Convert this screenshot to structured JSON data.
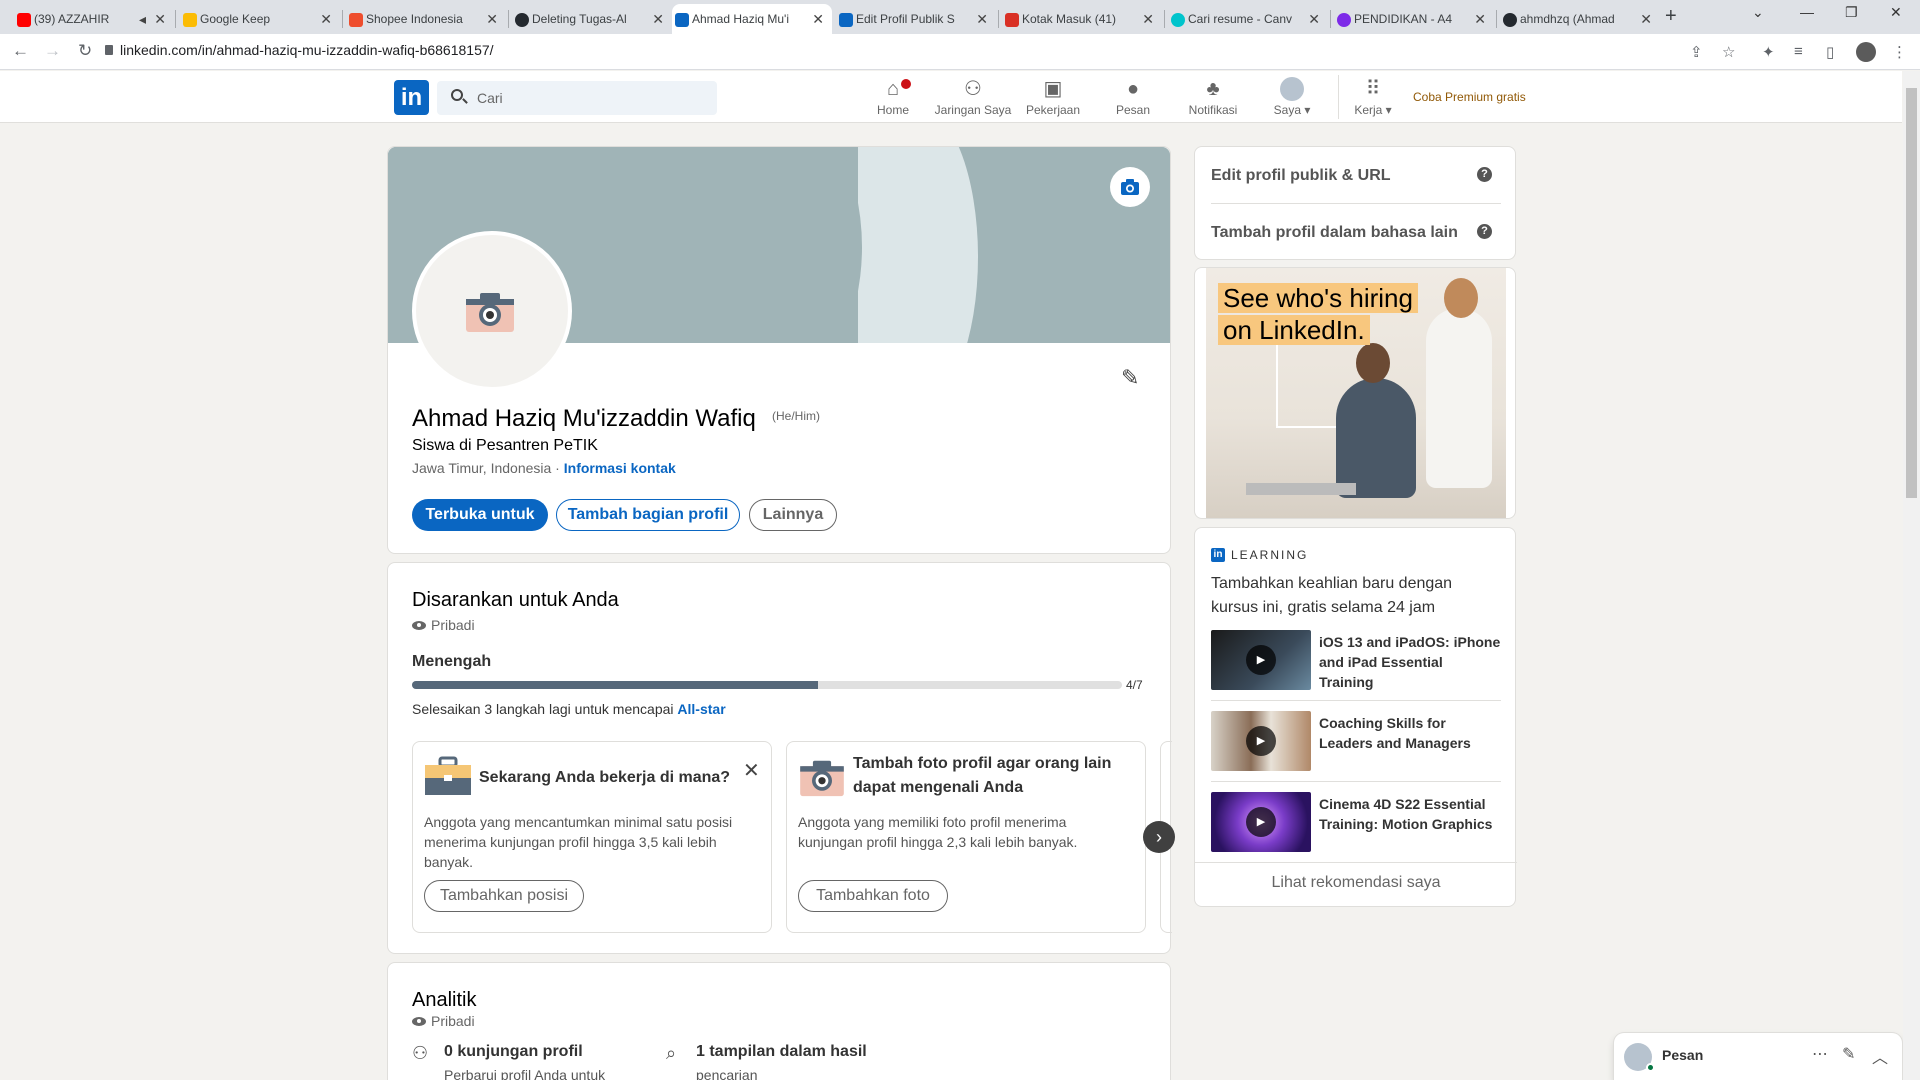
{
  "browser": {
    "tabs": [
      {
        "title": "(39) AZZAHIR",
        "fav_color": "#ff0000"
      },
      {
        "title": "Google Keep",
        "fav_color": "#fbbc04"
      },
      {
        "title": "Shopee Indonesia",
        "fav_color": "#ee4d2d"
      },
      {
        "title": "Deleting Tugas-Al",
        "fav_color": "#24292f"
      },
      {
        "title": "Ahmad Haziq Mu'i",
        "fav_color": "#0a66c2"
      },
      {
        "title": "Edit Profil Publik S",
        "fav_color": "#0a66c2"
      },
      {
        "title": "Kotak Masuk (41)",
        "fav_color": "#d93025"
      },
      {
        "title": "Cari resume - Canv",
        "fav_color": "#00c4cc"
      },
      {
        "title": "PENDIDIKAN - A4",
        "fav_color": "#7d2ae8"
      },
      {
        "title": "ahmdhzq (Ahmad",
        "fav_color": "#24292f"
      }
    ],
    "url": "linkedin.com/in/ahmad-haziq-mu-izzaddin-wafiq-b68618157/"
  },
  "nav": {
    "logo": "in",
    "search_placeholder": "Cari",
    "items": [
      {
        "label": "Home",
        "icon": "home-icon"
      },
      {
        "label": "Jaringan Saya",
        "icon": "network-icon"
      },
      {
        "label": "Pekerjaan",
        "icon": "briefcase-icon"
      },
      {
        "label": "Pesan",
        "icon": "message-icon"
      },
      {
        "label": "Notifikasi",
        "icon": "bell-icon"
      },
      {
        "label": "Saya ▾",
        "icon": "avatar"
      },
      {
        "label": "Kerja ▾",
        "icon": "grid-icon"
      }
    ],
    "premium": "Coba Premium gratis"
  },
  "profile": {
    "name": "Ahmad Haziq Mu'izzaddin Wafiq",
    "pronoun": "(He/Him)",
    "headline": "Siswa di Pesantren PeTIK",
    "location": "Jawa Timur, Indonesia · ",
    "contact_link": "Informasi kontak",
    "btn_open": "Terbuka untuk",
    "btn_add": "Tambah bagian profil",
    "btn_more": "Lainnya"
  },
  "suggested": {
    "title": "Disarankan untuk Anda",
    "private": "Pribadi",
    "level": "Menengah",
    "progress": 0.5714,
    "progress_label": "4/7",
    "note": "Selesaikan 3 langkah lagi untuk mencapai ",
    "note_link": "All-star",
    "cards": [
      {
        "title": "Sekarang Anda bekerja di mana?",
        "desc": "Anggota yang mencantumkan minimal satu posisi menerima kunjungan profil hingga 3,5 kali lebih banyak.",
        "button": "Tambahkan posisi"
      },
      {
        "title": "Tambah foto profil agar orang lain dapat mengenali Anda",
        "desc": "Anggota yang memiliki foto profil menerima kunjungan profil hingga 2,3 kali lebih banyak.",
        "button": "Tambahkan foto"
      }
    ]
  },
  "analytics": {
    "title": "Analitik",
    "private": "Pribadi",
    "visits": "0 kunjungan profil",
    "visits_sub": "Perbarui profil Anda untuk",
    "search": "1 tampilan dalam hasil",
    "search_sub": "pencarian"
  },
  "side": {
    "edit_public": "Edit profil publik & URL",
    "add_lang": "Tambah profil dalam bahasa lain",
    "ad_line1": "See who's hiring",
    "ad_line2": "on LinkedIn.",
    "learning_label": "LEARNING",
    "learning_title": "Tambahkan keahlian baru dengan kursus ini, gratis selama 24 jam",
    "courses": [
      {
        "title": "iOS 13 and iPadOS: iPhone and iPad Essential Training"
      },
      {
        "title": "Coaching Skills for Leaders and Managers"
      },
      {
        "title": "Cinema 4D S22 Essential Training: Motion Graphics"
      }
    ],
    "see_more": "Lihat rekomendasi saya"
  },
  "messaging": {
    "label": "Pesan"
  }
}
